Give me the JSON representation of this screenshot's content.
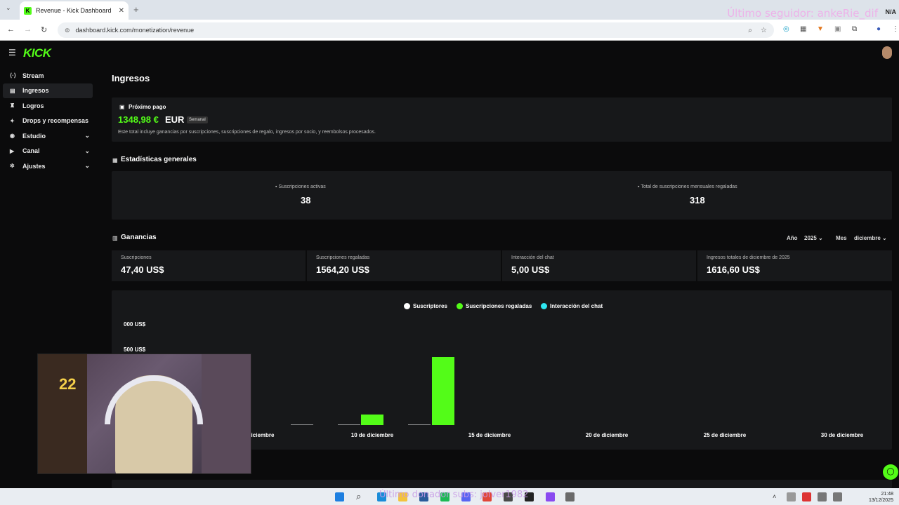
{
  "browser": {
    "tab_title": "Revenue - Kick Dashboard",
    "url": "dashboard.kick.com/monetization/revenue",
    "overlay_top": "Último seguidor: ankeRie_dif",
    "overlay_top_right": "N/A"
  },
  "header": {
    "logo": "KICK"
  },
  "sidebar": {
    "items": [
      {
        "label": "Stream",
        "icon": "stream-icon",
        "chevron": false,
        "active": false
      },
      {
        "label": "Ingresos",
        "icon": "revenue-icon",
        "chevron": false,
        "active": true
      },
      {
        "label": "Logros",
        "icon": "trophy-icon",
        "chevron": false,
        "active": false
      },
      {
        "label": "Drops y recompensas",
        "icon": "drops-icon",
        "chevron": false,
        "active": false
      },
      {
        "label": "Estudio",
        "icon": "studio-icon",
        "chevron": true,
        "active": false
      },
      {
        "label": "Canal",
        "icon": "channel-icon",
        "chevron": true,
        "active": false
      },
      {
        "label": "Ajustes",
        "icon": "gear-icon",
        "chevron": true,
        "active": false
      }
    ]
  },
  "page": {
    "title": "Ingresos"
  },
  "payout": {
    "label": "Próximo pago",
    "amount": "1348,98 €",
    "currency": "EUR",
    "badge": "Semanal",
    "note": "Este total incluye ganancias por suscripciones, suscripciones de regalo, ingresos por socio, y reembolsos procesados."
  },
  "general_stats": {
    "title": "Estadísticas generales",
    "active_subs_label": "Suscripciones activas",
    "active_subs_value": "38",
    "gifted_total_label": "Total de suscripciones mensuales regaladas",
    "gifted_total_value": "318"
  },
  "earnings": {
    "title": "Ganancias",
    "year_label": "Año",
    "year_value": "2025",
    "month_label": "Mes",
    "month_value": "diciembre",
    "subs_label": "Suscripciones",
    "subs_value": "47,40 US$",
    "gifted_label": "Suscripciones regaladas",
    "gifted_value": "1564,20 US$",
    "chat_label": "Interacción del chat",
    "chat_value": "5,00 US$",
    "total_label": "Ingresos totales de diciembre de 2025",
    "total_value": "1616,60 US$"
  },
  "chart_data": {
    "type": "bar",
    "series": [
      {
        "name": "Suscriptores",
        "color": "#ffffff"
      },
      {
        "name": "Suscripciones regaladas",
        "color": "#53fc18"
      },
      {
        "name": "Interacción del chat",
        "color": "#2ee6f0"
      }
    ],
    "y_ticks": [
      "000 US$",
      "500 US$"
    ],
    "x_ticks": [
      "iciembre",
      "10 de diciembre",
      "15 de diciembre",
      "20 de diciembre",
      "25 de diciembre",
      "30 de diciembre"
    ],
    "bars": [
      {
        "day": 7,
        "series": "Suscriptores",
        "value": 5
      },
      {
        "day": 9,
        "series": "Suscriptores",
        "value": 5
      },
      {
        "day": 10,
        "series": "Suscripciones regaladas",
        "value": 90
      },
      {
        "day": 12,
        "series": "Suscriptores",
        "value": 5
      },
      {
        "day": 13,
        "series": "Suscripciones regaladas",
        "value": 580
      }
    ]
  },
  "taskbar": {
    "overlay": "Último donador subs: jolver1982",
    "time": "21:48",
    "date": "13/12/2025"
  }
}
